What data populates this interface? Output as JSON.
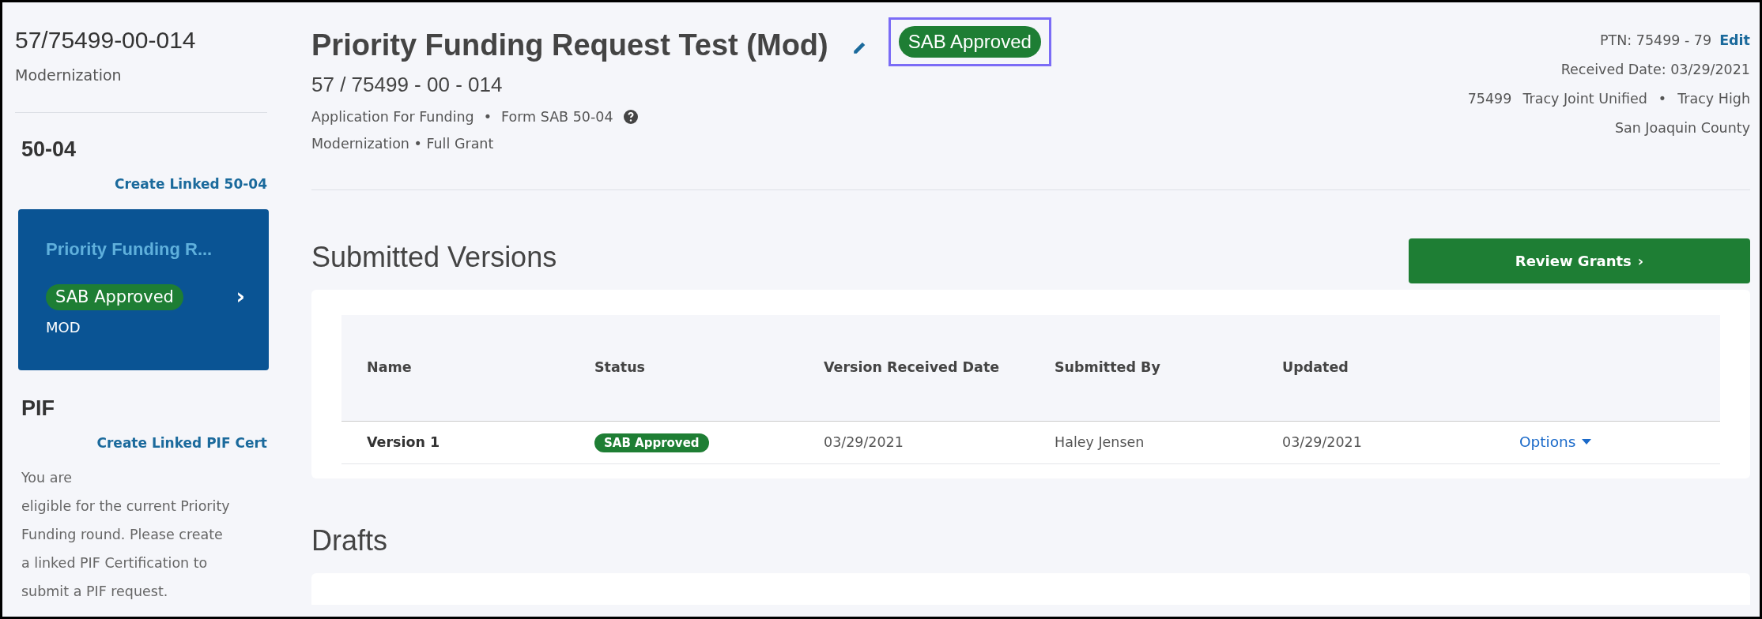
{
  "sidebar": {
    "project_number": "57/75499-00-014",
    "program": "Modernization",
    "sections": [
      {
        "heading": "50-04",
        "link": "Create Linked 50-04",
        "card": {
          "title": "Priority Funding R...",
          "status": "SAB Approved",
          "type": "MOD",
          "chevron": "›"
        }
      },
      {
        "heading": "PIF",
        "link": "Create Linked PIF Cert",
        "note_lines": [
          "You are",
          "eligible for the current Priority",
          "Funding round. Please create",
          "a linked PIF Certification to",
          "submit a PIF request."
        ]
      }
    ]
  },
  "header": {
    "title": "Priority Funding Request Test (Mod)",
    "status": "SAB Approved",
    "status_highlighted": true,
    "number": "57 / 75499 - 00 - 014",
    "meta": [
      "Application For Funding",
      "•",
      "Form SAB 50-04"
    ],
    "meta2": "Modernization • Full Grant"
  },
  "info": {
    "ptn": "PTN: 75499 - 79",
    "edit": "Edit",
    "received": "Received Date: 03/29/2021",
    "district_code": "75499",
    "district": "Tracy Joint Unified",
    "dot": "•",
    "school": "Tracy High",
    "county": "San Joaquin County"
  },
  "submitted": {
    "heading": "Submitted Versions",
    "button": "Review Grants",
    "button_chevron": "›",
    "columns": [
      "Name",
      "Status",
      "Version Received Date",
      "Submitted By",
      "Updated"
    ],
    "rows": [
      {
        "name": "Version 1",
        "status": "SAB Approved",
        "received": "03/29/2021",
        "by": "Haley Jensen",
        "updated": "03/29/2021",
        "options": "Options"
      }
    ]
  },
  "drafts": {
    "heading": "Drafts"
  }
}
